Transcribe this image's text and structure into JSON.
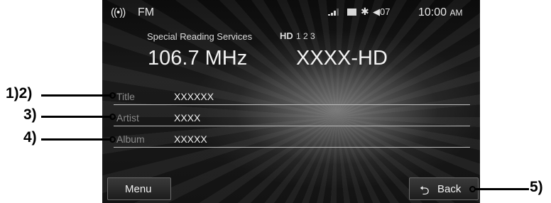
{
  "status_bar": {
    "band": "FM",
    "radio_icon": "radio-broadcast-icon",
    "volume": "07",
    "time": "10:00",
    "ampm": "AM"
  },
  "station_info": {
    "service_name": "Special Reading Services",
    "hd_icon": "HD",
    "channels": "1 2 3",
    "frequency": "106.7 MHz",
    "call_sign": "XXXX-HD"
  },
  "track_info": [
    {
      "label": "Title",
      "value": "XXXXXX"
    },
    {
      "label": "Artist",
      "value": "XXXX"
    },
    {
      "label": "Album",
      "value": "XXXXX"
    }
  ],
  "buttons": {
    "menu": "Menu",
    "back": "Back"
  },
  "callouts": {
    "title": "1)2)",
    "artist": "3)",
    "album": "4)",
    "back": "5)"
  }
}
